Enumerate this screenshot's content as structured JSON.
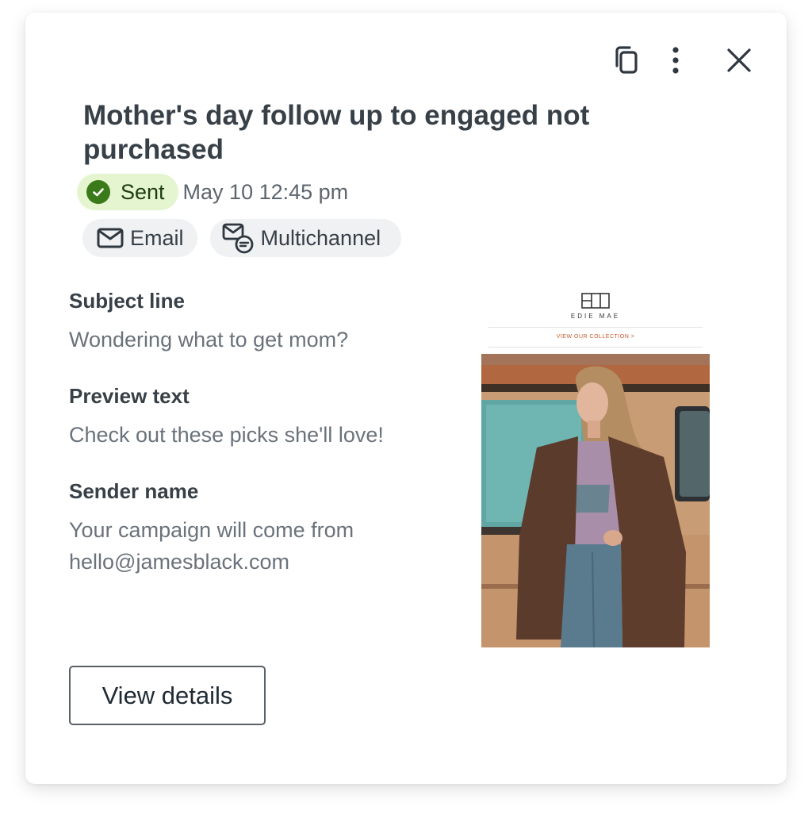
{
  "campaign": {
    "title": "Mother's day follow up to engaged not purchased",
    "status": "Sent",
    "sent_time": "May 10 12:45 pm",
    "channels": [
      "Email",
      "Multichannel"
    ]
  },
  "toolbar": {
    "icons": [
      "copy-icon",
      "more-options-icon",
      "close-icon"
    ]
  },
  "fields": [
    {
      "label": "Subject line",
      "value": "Wondering what to get mom?"
    },
    {
      "label": "Preview text",
      "value": "Check out these picks she'll love!"
    },
    {
      "label": "Sender name",
      "value": "Your campaign will come from hello@jamesblack.com"
    }
  ],
  "email_preview": {
    "brand": "EDIE MAE",
    "cta": "VIEW OUR COLLECTION >"
  },
  "actions": {
    "view_details_label": "View details"
  },
  "colors": {
    "sent_badge_bg": "#e4f5cf",
    "sent_check": "#3b7a1a",
    "chip_bg": "#eff1f3",
    "title": "#373f47"
  }
}
